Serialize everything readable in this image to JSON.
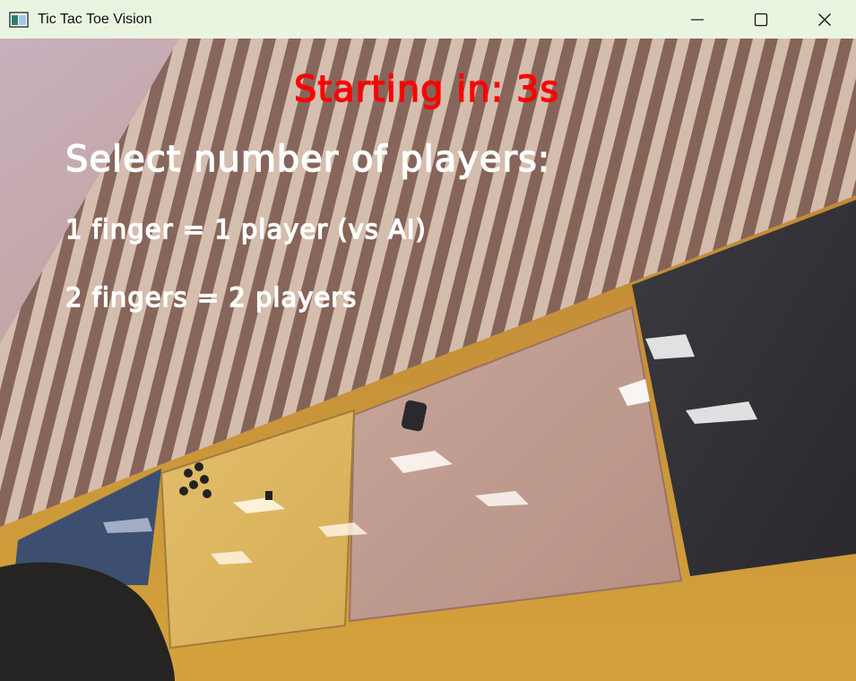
{
  "window": {
    "title": "Tic Tac Toe Vision",
    "controls": {
      "minimize": "minimize-icon",
      "maximize": "maximize-icon",
      "close": "close-icon"
    }
  },
  "overlay": {
    "countdown": "Starting in: 3s",
    "prompt": "Select number of players:",
    "options": [
      "1 finger = 1 player (vs AI)",
      "2 fingers = 2 players"
    ]
  },
  "colors": {
    "countdown": "#ff0000",
    "prompt": "#ffffff",
    "titlebar": "#eaf5e1"
  }
}
